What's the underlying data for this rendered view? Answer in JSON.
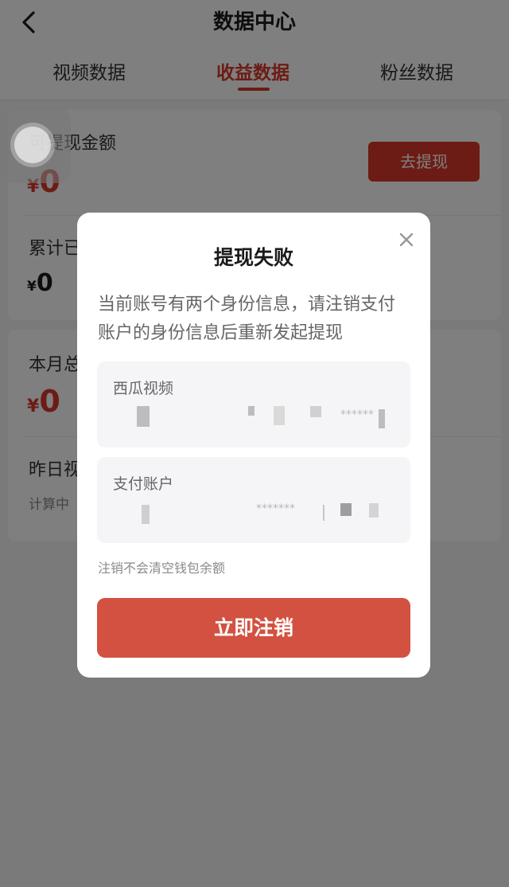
{
  "header": {
    "title": "数据中心",
    "back_icon": "chevron-left-icon"
  },
  "tabs": [
    {
      "label": "视频数据",
      "active": false
    },
    {
      "label": "收益数据",
      "active": true
    },
    {
      "label": "粉丝数据",
      "active": false
    }
  ],
  "earnings": {
    "withdrawable_label": "可提现金额",
    "currency": "¥",
    "withdrawable_amount": "0",
    "withdraw_button": "去提现",
    "total_withdrawn_label": "累计已",
    "total_withdrawn_amount": "0",
    "month_total_label": "本月总",
    "month_total_amount": "0",
    "yesterday_label": "昨日视",
    "yesterday_status": "计算中"
  },
  "dialog": {
    "title": "提现失败",
    "message": "当前账号有两个身份信息，请注销支付账户的身份信息后重新发起提现",
    "close_icon": "close-icon",
    "accounts": [
      {
        "label": "西瓜视频",
        "masked_value": "******"
      },
      {
        "label": "支付账户",
        "masked_value": "*******"
      }
    ],
    "note": "注销不会清空钱包余额",
    "confirm_button": "立即注销"
  },
  "colors": {
    "accent": "#d9392b",
    "dialog_button": "#d35140",
    "overlay": "rgba(0,0,0,0.5)"
  }
}
